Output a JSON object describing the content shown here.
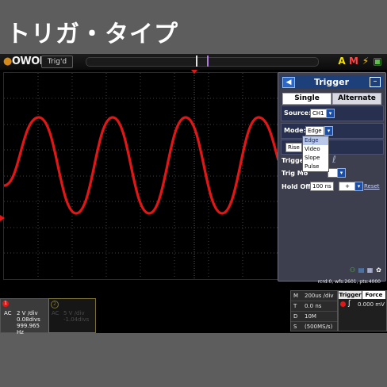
{
  "headline": "トリガ・タイプ",
  "topbar": {
    "logo": "OWON",
    "trig_status": "Trig'd",
    "icons": [
      "run-stop-icon",
      "math-icon",
      "power-icon",
      "usb-icon"
    ]
  },
  "colors": {
    "waveform": "#e11717",
    "panel_header": "#1d3f7a",
    "panel_bg": "#3d3f4e",
    "trigger_marker": "#e01818"
  },
  "trigger_panel": {
    "title": "Trigger",
    "modes": [
      "Single",
      "Alternate"
    ],
    "source_label": "Source:",
    "source_value": "CH1",
    "mode_label": "Mode:",
    "mode_value": "Edge",
    "mode_options": [
      "Edge",
      "Video",
      "Slope",
      "Pulse"
    ],
    "mode_selected_index": 0,
    "slope_value": "Rise",
    "trigger_label": "Trigge",
    "trig_mode_label": "Trig Mo",
    "holdoff_label": "Hold Off:",
    "holdoff_value": "100 ns",
    "holdoff_step": "+",
    "reset_label": "Reset"
  },
  "status": {
    "line": "rcrd:0, wfs:2601, pts:4000"
  },
  "channel1": {
    "number": "1",
    "coupling": "AC",
    "scale": "2 V /div",
    "offset": "0.08divs",
    "frequency": "999.965 Hz"
  },
  "channel2": {
    "number": "2",
    "coupling": "AC",
    "scale": "5 V /div",
    "offset": "-1.04divs"
  },
  "timebase": {
    "rows": [
      {
        "key": "M",
        "value": "200us /div"
      },
      {
        "key": "T",
        "value": "0.0 ns"
      },
      {
        "key": "D",
        "value": "10M"
      },
      {
        "key": "S",
        "value": "(500MS/s)"
      }
    ]
  },
  "trigger_info": {
    "tabs": [
      "Trigger",
      "Force"
    ],
    "level": "0.000 mV"
  }
}
